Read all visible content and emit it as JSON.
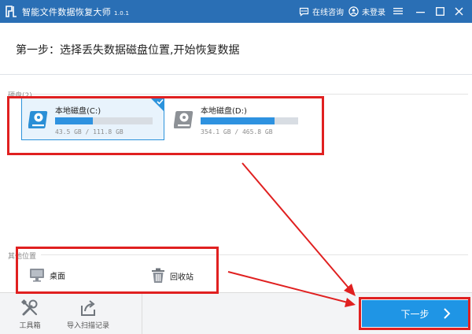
{
  "window": {
    "title": "智能文件数据恢复大师",
    "version": "1.0.1",
    "chat_label": "在线咨询",
    "user_label": "未登录",
    "accent": "#2a6fb5"
  },
  "step": {
    "text": "第一步：选择丢失数据磁盘位置,开始恢复数据"
  },
  "disks": {
    "label": "硬盘(2)",
    "items": [
      {
        "name": "本地磁盘(C:)",
        "size": "43.5 GB / 111.8 GB",
        "used_fraction": 0.389,
        "selected": true
      },
      {
        "name": "本地磁盘(D:)",
        "size": "354.1 GB / 465.8 GB",
        "used_fraction": 0.76,
        "selected": false
      }
    ]
  },
  "other_locations": {
    "label": "其他位置",
    "items": [
      {
        "name": "桌面",
        "icon": "desktop-icon"
      },
      {
        "name": "回收站",
        "icon": "recycle-bin-icon"
      }
    ]
  },
  "bottom": {
    "toolbox_label": "工具箱",
    "import_label": "导入扫描记录",
    "next_label": "下一步"
  },
  "colors": {
    "button_blue": "#1f95e5",
    "annotation_red": "#e02020"
  }
}
